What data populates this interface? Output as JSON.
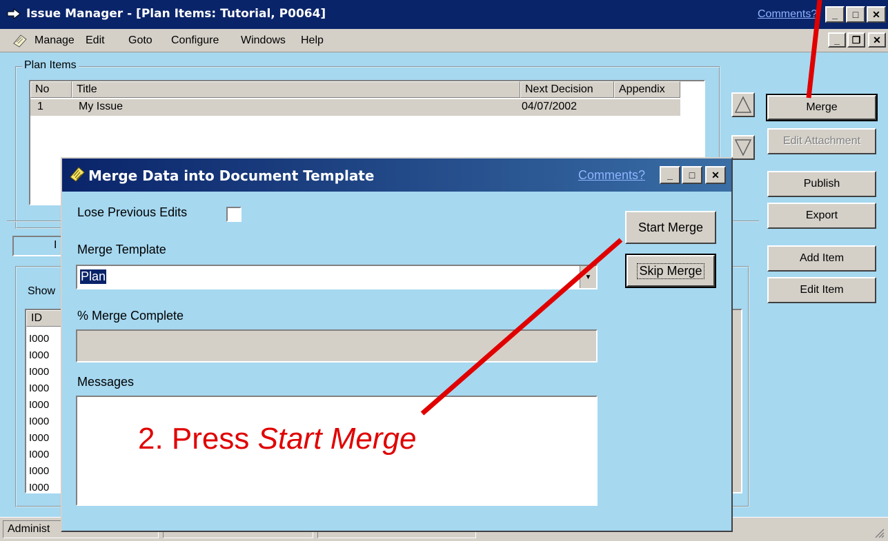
{
  "app": {
    "title": "Issue Manager - [Plan Items: Tutorial, P0064]",
    "comments_link": "Comments?"
  },
  "menu": [
    "Manage",
    "Edit",
    "Goto",
    "Configure",
    "Windows",
    "Help"
  ],
  "plan_items": {
    "group_label": "Plan Items",
    "columns": [
      "No",
      "Title",
      "Next Decision",
      "Appendix"
    ],
    "rows": [
      {
        "no": "1",
        "title": "My Issue",
        "next_decision": "04/07/2002",
        "appendix": ""
      }
    ]
  },
  "side_buttons": {
    "merge": "Merge",
    "edit_attachment": "Edit Attachment",
    "publish": "Publish",
    "export": "Export",
    "add_item": "Add Item",
    "edit_item": "Edit Item"
  },
  "background_partial": {
    "tab_fragment": "I",
    "show_label": "Show",
    "id_header": "ID",
    "id_values": [
      "I000",
      "I000",
      "I000",
      "I000",
      "I000",
      "I000",
      "I000",
      "I000",
      "I000",
      "I000"
    ]
  },
  "status": {
    "cell1": "Administ"
  },
  "dialog": {
    "title": "Merge Data into Document Template",
    "comments_link": "Comments?",
    "lose_previous_edits_label": "Lose Previous Edits",
    "lose_previous_edits_checked": false,
    "merge_template_label": "Merge Template",
    "merge_template_value": "Plan",
    "percent_complete_label": "% Merge Complete",
    "percent_complete_value": 0,
    "messages_label": "Messages",
    "start_merge": "Start Merge",
    "skip_merge": "Skip Merge"
  },
  "annotation": {
    "prefix": "2. Press ",
    "emphasis": "Start Merge",
    "color": "#e00000"
  }
}
